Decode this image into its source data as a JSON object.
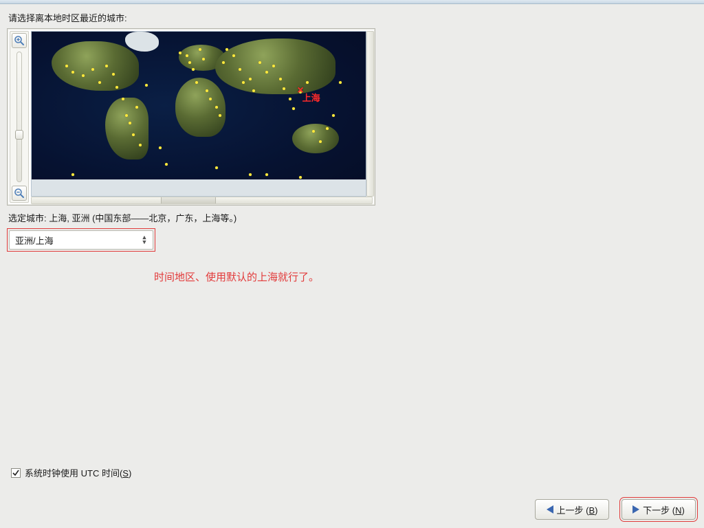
{
  "prompt_label": "请选择离本地时区最近的城市:",
  "map": {
    "selected_city_label": "上海",
    "zoom_in_name": "zoom-in",
    "zoom_out_name": "zoom-out"
  },
  "city_line": {
    "prefix": "选定城市: ",
    "value": "上海, 亚洲 (中国东部——北京，广东，上海等。)"
  },
  "timezone_combo": {
    "value": "亚洲/上海"
  },
  "annotation": "时间地区、使用默认的上海就行了。",
  "utc_checkbox": {
    "checked": true,
    "label_pre": "系统时钟使用 UTC 时间(",
    "mnemonic": "S",
    "label_post": ")"
  },
  "nav": {
    "back": {
      "label_pre": "上一步 (",
      "mnemonic": "B",
      "label_post": ")"
    },
    "next": {
      "label_pre": "下一步 (",
      "mnemonic": "N",
      "label_post": ")"
    }
  }
}
